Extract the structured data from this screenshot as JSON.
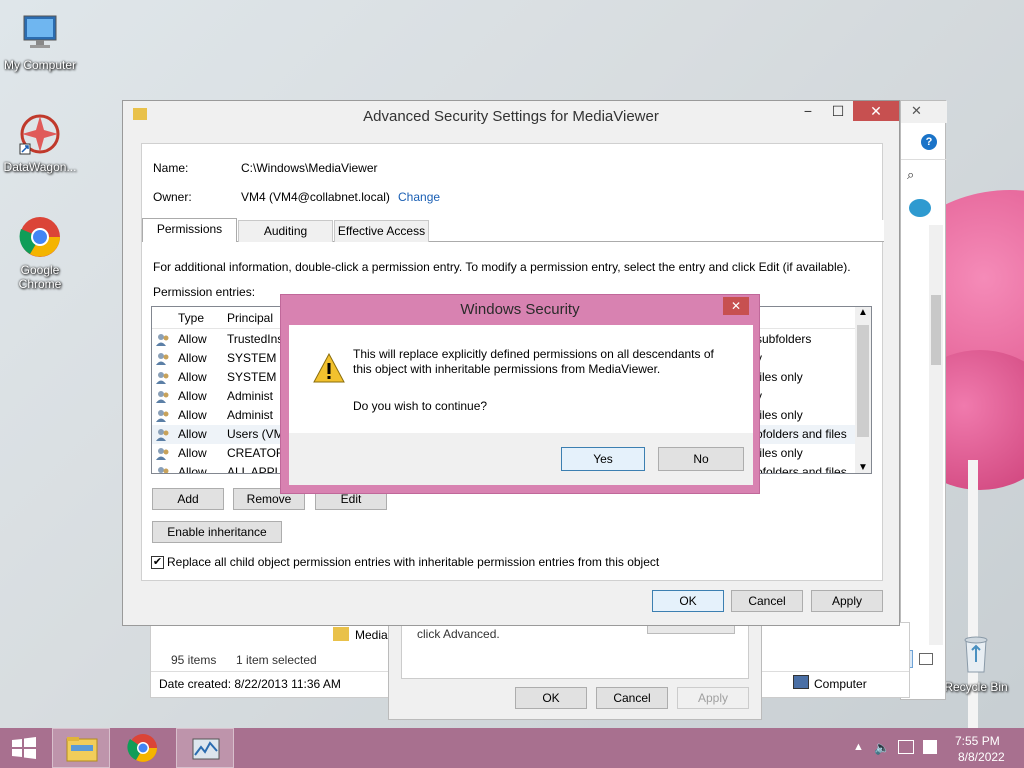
{
  "desktop": {
    "icons": [
      {
        "label": "My Computer",
        "icon": "computer-icon"
      },
      {
        "label": "DataWagon...",
        "icon": "datawagon-icon"
      },
      {
        "label": "Google Chrome",
        "icon": "chrome-icon"
      },
      {
        "label": "Recycle Bin",
        "icon": "recycle-bin-icon"
      }
    ]
  },
  "explorer": {
    "folder_label": "Media",
    "items_count": "95 items",
    "selected": "1 item selected",
    "date_created": "Date created: 8/22/2013 11:36 AM",
    "computer_label": "Computer"
  },
  "props_dialog": {
    "advanced_text": "click Advanced.",
    "ok": "OK",
    "cancel": "Cancel",
    "apply": "Apply"
  },
  "advanced": {
    "title": "Advanced Security Settings for MediaViewer",
    "name_label": "Name:",
    "name_value": "C:\\Windows\\MediaViewer",
    "owner_label": "Owner:",
    "owner_value": "VM4 (VM4@collabnet.local)",
    "change_link": "Change",
    "tabs": [
      "Permissions",
      "Auditing",
      "Effective Access"
    ],
    "info_text": "For additional information, double-click a permission entry. To modify a permission entry, select the entry and click Edit (if available).",
    "entries_label": "Permission entries:",
    "columns": {
      "type": "Type",
      "principal": "Principal"
    },
    "rows": [
      {
        "type": "Allow",
        "principal": "TrustedIns",
        "applies": "subfolders"
      },
      {
        "type": "Allow",
        "principal": "SYSTEM",
        "applies": "y"
      },
      {
        "type": "Allow",
        "principal": "SYSTEM",
        "applies": "files only"
      },
      {
        "type": "Allow",
        "principal": "Administ",
        "applies": "y"
      },
      {
        "type": "Allow",
        "principal": "Administ",
        "applies": "files only"
      },
      {
        "type": "Allow",
        "principal": "Users (VM",
        "applies": "ofolders and files"
      },
      {
        "type": "Allow",
        "principal": "CREATOR",
        "applies": "files only"
      },
      {
        "type": "Allow",
        "principal": "ALL APPLI",
        "applies": "ofolders and files"
      }
    ],
    "add": "Add",
    "remove": "Remove",
    "edit": "Edit",
    "enable_inheritance": "Enable inheritance",
    "replace_checkbox": "Replace all child object permission entries with inheritable permission entries from this object",
    "replace_checked": true,
    "ok": "OK",
    "cancel": "Cancel",
    "apply": "Apply"
  },
  "security_dialog": {
    "title": "Windows Security",
    "close": "✕",
    "message": "This will replace explicitly defined permissions on all descendants of this object with inheritable permissions from MediaViewer.",
    "question": "Do you wish to continue?",
    "yes": "Yes",
    "no": "No"
  },
  "taskbar": {
    "time": "7:55 PM",
    "date": "8/8/2022"
  },
  "colors": {
    "taskbar": "#a8708f",
    "dialog_frame": "#d882b1",
    "link": "#1a5fb4",
    "close_red": "#c75050"
  }
}
